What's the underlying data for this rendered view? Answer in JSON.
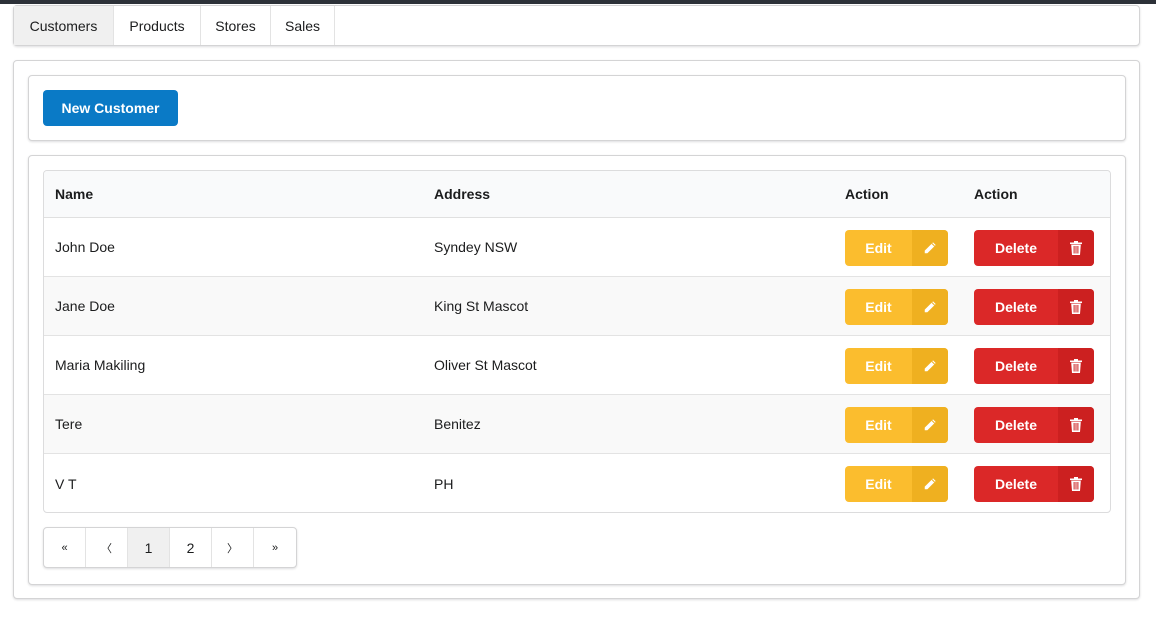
{
  "tabs": [
    {
      "label": "Customers",
      "active": true
    },
    {
      "label": "Products",
      "active": false
    },
    {
      "label": "Stores",
      "active": false
    },
    {
      "label": "Sales",
      "active": false
    }
  ],
  "toolbar": {
    "new_label": "New Customer"
  },
  "table": {
    "headers": {
      "name": "Name",
      "address": "Address",
      "action1": "Action",
      "action2": "Action"
    },
    "rows": [
      {
        "name": "John Doe",
        "address": "Syndey NSW"
      },
      {
        "name": "Jane Doe",
        "address": "King St Mascot"
      },
      {
        "name": "Maria Makiling",
        "address": "Oliver St Mascot"
      },
      {
        "name": "Tere",
        "address": "Benitez"
      },
      {
        "name": "V T",
        "address": "PH"
      }
    ],
    "edit_label": "Edit",
    "delete_label": "Delete",
    "edit_icon": "pencil-icon",
    "delete_icon": "trash-icon"
  },
  "pagination": {
    "first": "«",
    "prev": "〈",
    "pages": [
      "1",
      "2"
    ],
    "current": "1",
    "next": "〉",
    "last": "»"
  },
  "colors": {
    "primary": "#0a7ac6",
    "edit": "#fbbd2e",
    "delete": "#db2828"
  }
}
